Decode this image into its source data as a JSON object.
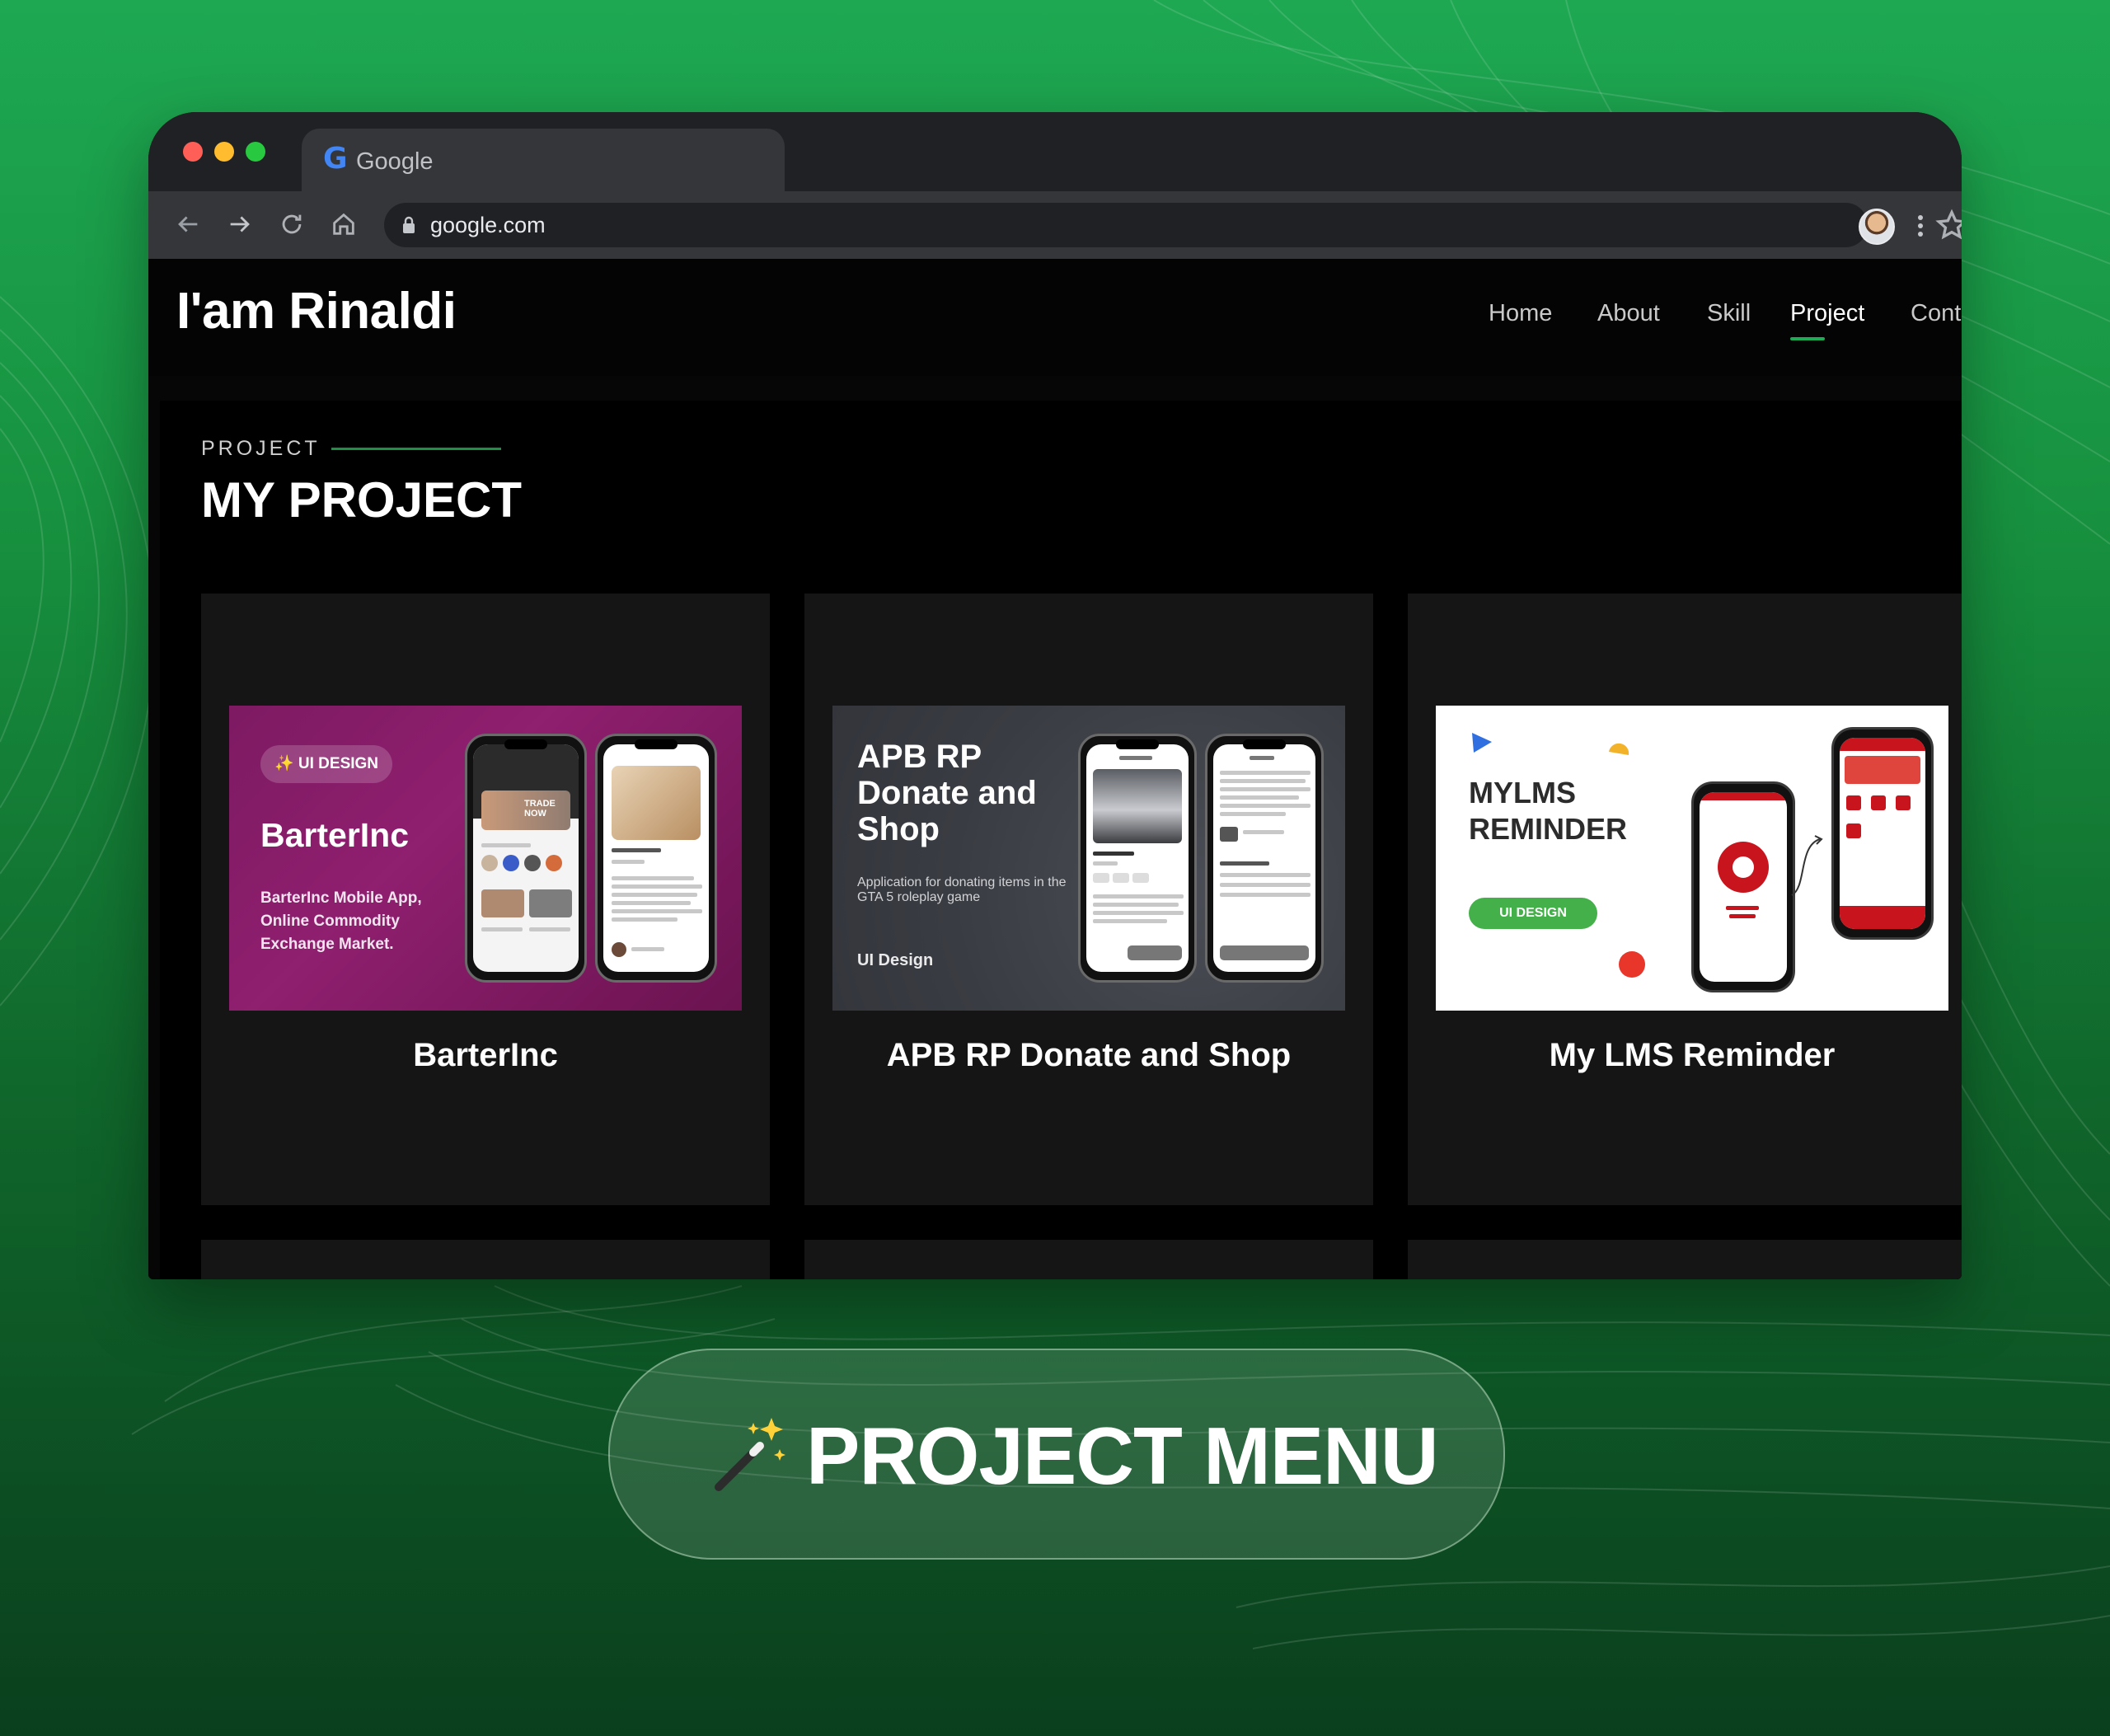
{
  "browser": {
    "tab_title": "Google",
    "tab_logo": "G",
    "url": "google.com",
    "icons": [
      "back-arrow-icon",
      "forward-arrow-icon",
      "reload-icon",
      "home-icon",
      "lock-icon",
      "star-icon",
      "avatar",
      "kebab-menu-icon"
    ]
  },
  "site": {
    "logo": "I'am Rinaldi",
    "nav": [
      {
        "label": "Home"
      },
      {
        "label": "About"
      },
      {
        "label": "Skill"
      },
      {
        "label": "Project",
        "active": true
      },
      {
        "label": "Cont"
      }
    ]
  },
  "section": {
    "eyebrow": "PROJECT",
    "title": "MY PROJECT"
  },
  "projects": [
    {
      "title": "BarterInc",
      "thumb": {
        "pill": "UI DESIGN",
        "brand": "BarterInc",
        "desc": "BarterInc Mobile App, Online Commodity Exchange Market.",
        "phone_text": "TRADE NOW"
      }
    },
    {
      "title": "APB RP Donate and Shop",
      "thumb": {
        "headline": "APB RP Donate and Shop",
        "desc": "Application for donating items in the GTA 5 roleplay game",
        "tag": "UI Design"
      }
    },
    {
      "title": "My LMS Reminder",
      "thumb": {
        "headline": "MYLMS REMINDER",
        "pill": "UI DESIGN"
      }
    }
  ],
  "banner": {
    "icon": "magic-wand-icon",
    "label": "PROJECT MENU"
  },
  "colors": {
    "accent": "#1faa55",
    "background_top": "#1ea852",
    "background_bottom": "#0a3f1d",
    "browser_chrome": "#202124",
    "card": "#151515",
    "barter_purple": "#8f1f6f",
    "lms_green": "#44b049",
    "lms_red": "#c8141c"
  }
}
